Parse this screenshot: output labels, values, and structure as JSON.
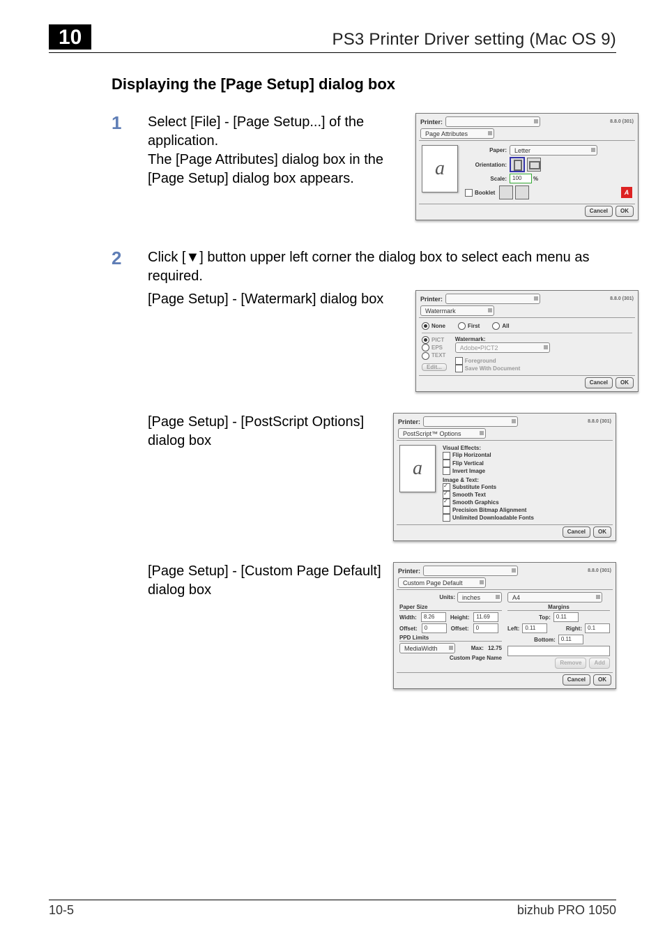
{
  "header": {
    "chapter": "10",
    "title": "PS3 Printer Driver setting (Mac OS 9)"
  },
  "section_heading": "Displaying the [Page Setup] dialog box",
  "step1": {
    "num": "1",
    "line1": "Select [File] - [Page Setup...] of the application.",
    "line2": "The [Page Attributes] dialog box in the [Page Setup] dialog box appears."
  },
  "dialog_page_attr": {
    "printer_label": "Printer:",
    "panel": "Page Attributes",
    "version": "8.8.0 (301)",
    "paper_label": "Paper:",
    "paper_value": "Letter",
    "orientation_label": "Orientation:",
    "scale_label": "Scale:",
    "scale_value": "100",
    "scale_pct": "%",
    "booklet_label": "Booklet",
    "preview_glyph": "a",
    "cancel": "Cancel",
    "ok": "OK"
  },
  "step2": {
    "num": "2",
    "line": "Click [▼] button upper left corner the dialog box to select each menu as required.",
    "sub_watermark": "[Page Setup] - [Watermark] dialog box",
    "sub_ps": "[Page Setup] - [PostScript Options] dialog box",
    "sub_custom": "[Page Setup] - [Custom Page Default] dialog box"
  },
  "dialog_watermark": {
    "printer_label": "Printer:",
    "panel": "Watermark",
    "version": "8.8.0 (301)",
    "opt_none": "None",
    "opt_first": "First",
    "opt_all": "All",
    "type_pict": "PICT",
    "type_eps": "EPS",
    "type_text": "TEXT",
    "wm_label": "Watermark:",
    "wm_value": "Adobe•PICT2",
    "foreground": "Foreground",
    "save_doc": "Save With Document",
    "edit": "Edit...",
    "cancel": "Cancel",
    "ok": "OK"
  },
  "dialog_ps": {
    "printer_label": "Printer:",
    "panel": "PostScript™ Options",
    "version": "8.8.0 (301)",
    "ve_head": "Visual Effects:",
    "flip_h": "Flip Horizontal",
    "flip_v": "Flip Vertical",
    "invert": "Invert Image",
    "it_head": "Image & Text:",
    "sub_fonts": "Substitute Fonts",
    "smooth_text": "Smooth Text",
    "smooth_gfx": "Smooth Graphics",
    "precision": "Precision Bitmap Alignment",
    "unlimited": "Unlimited Downloadable Fonts",
    "preview_glyph": "a",
    "cancel": "Cancel",
    "ok": "OK"
  },
  "dialog_custom": {
    "printer_label": "Printer:",
    "panel": "Custom Page Default",
    "version": "8.8.0 (301)",
    "units_label": "Units:",
    "units_value": "inches",
    "page_select": "A4",
    "paper_size_head": "Paper Size",
    "margins_head": "Margins",
    "width_label": "Width:",
    "width_val": "8.26",
    "height_label": "Height:",
    "height_val": "11.69",
    "offset1_label": "Offset:",
    "offset1_val": "0",
    "offset2_label": "Offset:",
    "offset2_val": "0",
    "top_label": "Top:",
    "top_val": "0.11",
    "left_label": "Left:",
    "left_val": "0.11",
    "right_label": "Right:",
    "right_val": "0.1",
    "bottom_label": "Bottom:",
    "bottom_val": "0.11",
    "ppd_head": "PPD Limits",
    "ppd_select": "MediaWidth",
    "ppd_max_label": "Max:",
    "ppd_max_val": "12.75",
    "cpn_label": "Custom Page Name",
    "remove": "Remove",
    "add": "Add",
    "cancel": "Cancel",
    "ok": "OK"
  },
  "footer": {
    "page": "10-5",
    "product": "bizhub PRO 1050"
  }
}
